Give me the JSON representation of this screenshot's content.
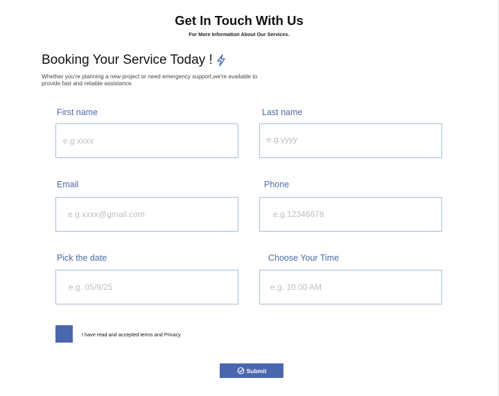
{
  "header": {
    "title": "Get In Touch With Us",
    "subtitle": "For More Information About Our  Services."
  },
  "section": {
    "title": "Booking Your Service Today !",
    "title_icon": "lightning-bolt-icon",
    "description": "Whether you're planning a new project or need emergency support,we're available to provide fast and reliable assistance."
  },
  "form": {
    "first_name": {
      "label": "First name",
      "placeholder": "e.g xxxx"
    },
    "last_name": {
      "label": "Last name",
      "placeholder": "e.g.yyyy"
    },
    "email": {
      "label": "Email",
      "placeholder": "e.g xxxx@gmail.com"
    },
    "phone": {
      "label": "Phone",
      "placeholder": "e.g.12346678"
    },
    "date": {
      "label": "Pick the date",
      "placeholder": "e.g. 05/9/25"
    },
    "time": {
      "label": "Choose Your Time",
      "placeholder": "e.g. 10.00 AM"
    },
    "terms_label": "I have read and accepted terms and Privacy",
    "submit_label": "Submit",
    "submit_icon": "submit-check-icon"
  },
  "colors": {
    "accent": "#4a67ad",
    "label": "#4a6aa5",
    "input_border": "#a7bcd0"
  }
}
